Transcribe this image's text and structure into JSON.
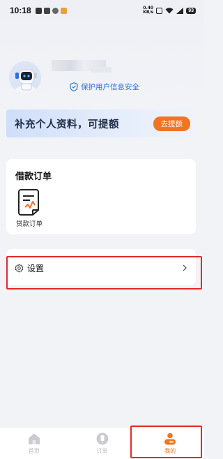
{
  "status_bar": {
    "time": "10:18",
    "net_speed_value": "0.40",
    "net_speed_unit": "KB/s",
    "battery": "93"
  },
  "profile": {
    "privacy_text": "保护用户信息安全"
  },
  "banner": {
    "text": "补充个人资料，可提额",
    "button_label": "去提额"
  },
  "loan_section": {
    "title": "借款订单",
    "item_label": "贷款订单"
  },
  "settings": {
    "label": "设置"
  },
  "tabbar": {
    "tabs": [
      {
        "label": "首页",
        "icon": "home-icon"
      },
      {
        "label": "订单",
        "icon": "order-icon"
      },
      {
        "label": "我的",
        "icon": "profile-icon"
      }
    ],
    "active_index": 2
  },
  "colors": {
    "accent": "#f07522",
    "link_blue": "#2d6fd8",
    "annotation_red": "#e52a2a"
  }
}
